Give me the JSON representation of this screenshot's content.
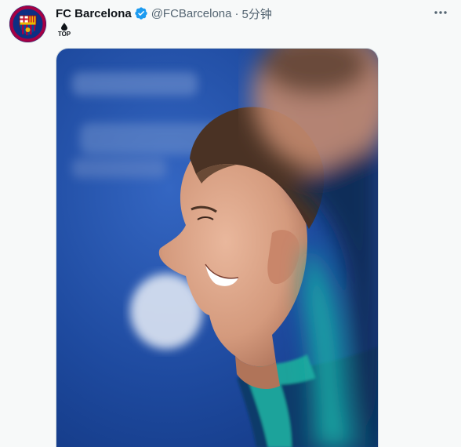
{
  "tweet": {
    "display_name": "FC Barcelona",
    "handle": "@FCBarcelona",
    "separator": "·",
    "time": "5分钟",
    "badge": "TOP",
    "avatar": "fc-barcelona-crest",
    "verified_icon": "verified-badge-icon",
    "more_icon": "more-options-icon",
    "media": "photo-smiling-player-profile"
  },
  "colors": {
    "verified": "#1d9bf0",
    "name": "#0f1419",
    "secondary": "#536471",
    "background": "#f7f9f9",
    "photo_bg": "#1d4aa3"
  }
}
